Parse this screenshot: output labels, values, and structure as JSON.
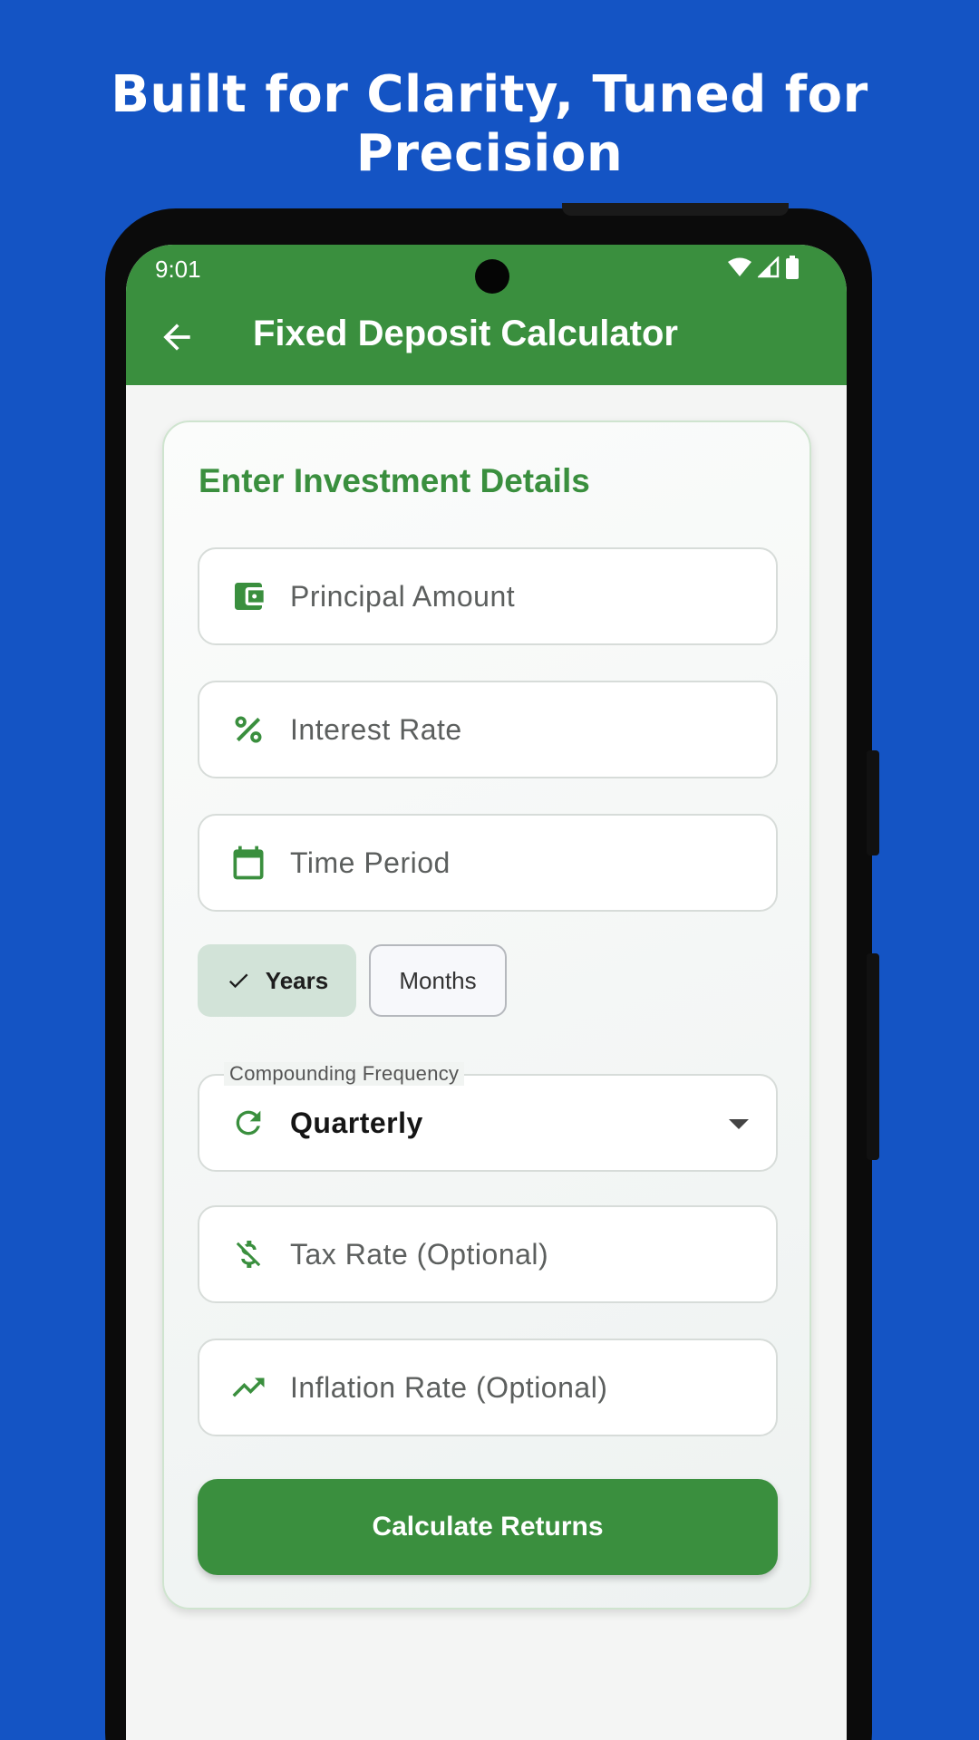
{
  "headline": "Built for Clarity, Tuned for Precision",
  "status_bar": {
    "time": "9:01"
  },
  "app_bar": {
    "title": "Fixed Deposit Calculator",
    "back_icon": "arrow-back-icon"
  },
  "form": {
    "section_title": "Enter Investment Details",
    "principal": {
      "placeholder": "Principal Amount",
      "icon": "wallet-icon"
    },
    "interest": {
      "placeholder": "Interest Rate",
      "icon": "percent-icon"
    },
    "time_period": {
      "placeholder": "Time Period",
      "icon": "calendar-icon"
    },
    "period_unit": {
      "options": [
        "Years",
        "Months"
      ],
      "selected": "Years"
    },
    "compounding": {
      "label": "Compounding Frequency",
      "value": "Quarterly",
      "icon": "refresh-icon"
    },
    "tax_rate": {
      "placeholder": "Tax Rate (Optional)",
      "icon": "money-off-icon"
    },
    "inflation_rate": {
      "placeholder": "Inflation Rate (Optional)",
      "icon": "trending-up-icon"
    },
    "submit_label": "Calculate Returns"
  },
  "colors": {
    "background": "#1454c4",
    "primary": "#3a8f3e",
    "chip_selected": "#d2e3d8"
  }
}
